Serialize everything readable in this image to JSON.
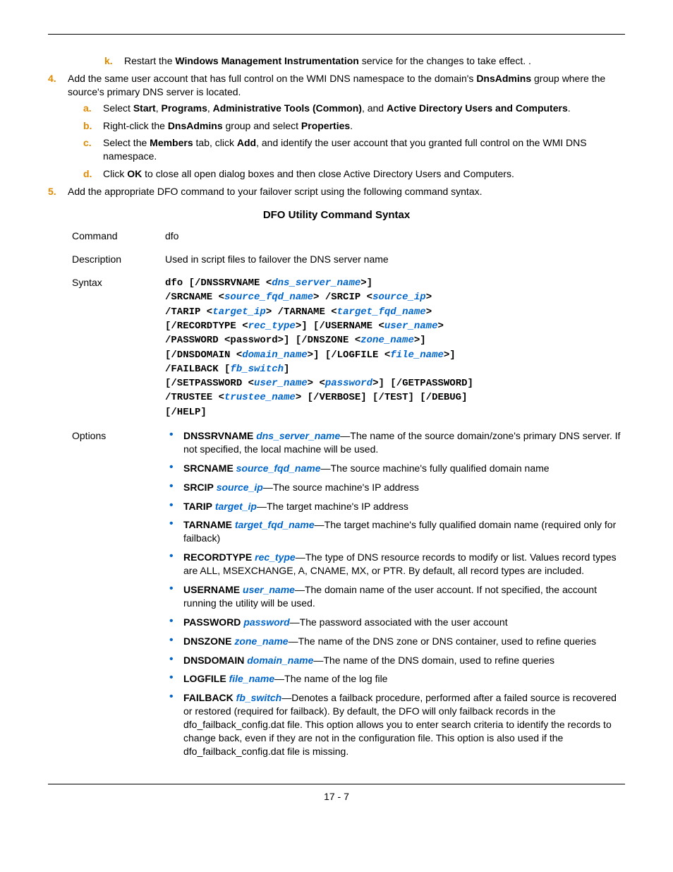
{
  "pageNumber": "17 - 7",
  "step_k_marker": "k.",
  "step_k_p1": "Restart the ",
  "step_k_b1": "Windows Management Instrumentation",
  "step_k_p2": " service for the changes to take effect. .",
  "step_4_marker": "4.",
  "step_4_p1": "Add the same user account that has full control on the WMI DNS namespace to the domain's ",
  "step_4_b1": "DnsAdmins",
  "step_4_p2": " group where the source's primary DNS server is located.",
  "step_4a_marker": "a.",
  "step_4a_p1": "Select ",
  "step_4a_b1": "Start",
  "step_4a_p2": ", ",
  "step_4a_b2": "Programs",
  "step_4a_p3": ", ",
  "step_4a_b3": "Administrative Tools (Common)",
  "step_4a_p4": ", and ",
  "step_4a_b4": "Active Directory Users and Computers",
  "step_4a_p5": ".",
  "step_4b_marker": "b.",
  "step_4b_p1": "Right-click the ",
  "step_4b_b1": "DnsAdmins",
  "step_4b_p2": " group and select ",
  "step_4b_b2": "Properties",
  "step_4b_p3": ".",
  "step_4c_marker": "c.",
  "step_4c_p1": "Select the ",
  "step_4c_b1": "Members",
  "step_4c_p2": " tab, click ",
  "step_4c_b2": "Add",
  "step_4c_p3": ", and identify the user account that you granted full control on the WMI DNS namespace.",
  "step_4d_marker": "d.",
  "step_4d_p1": "Click ",
  "step_4d_b1": "OK",
  "step_4d_p2": " to close all open dialog boxes and then close Active Directory Users and Computers.",
  "step_5_marker": "5.",
  "step_5_p1": "Add the appropriate DFO command to your failover script using the following command syntax.",
  "sectionTitle": "DFO Utility Command Syntax",
  "labels": {
    "command": "Command",
    "description": "Description",
    "syntax": "Syntax",
    "options": "Options"
  },
  "commandVal": "dfo",
  "descriptionVal": "Used in script files to failover the DNS server name",
  "syntax": {
    "s1a": "dfo [/DNSSRVNAME <",
    "s1p": "dns_server_name",
    "s1b": ">]",
    "s2a": "/SRCNAME <",
    "s2p": "source_fqd_name",
    "s2b": "> /SRCIP <",
    "s2p2": "source_ip",
    "s2c": ">",
    "s3a": "/TARIP <",
    "s3p": "target_ip",
    "s3b": "> /TARNAME <",
    "s3p2": "target_fqd_name",
    "s3c": ">",
    "s4a": "[/RECORDTYPE <",
    "s4p": "rec_type",
    "s4b": ">] [/USERNAME <",
    "s4p2": "user_name",
    "s4c": ">",
    "s5a": "/PASSWORD <password>] [/DNSZONE <",
    "s5p": "zone_name",
    "s5b": ">]",
    "s6a": "[/DNSDOMAIN <",
    "s6p": "domain_name",
    "s6b": ">] [/LOGFILE <",
    "s6p2": "file_name",
    "s6c": ">]",
    "s7a": "/FAILBACK [",
    "s7p": "fb_switch",
    "s7b": "]",
    "s8a": "[/SETPASSWORD <",
    "s8p": "user_name",
    "s8b": "> <",
    "s8p2": "password",
    "s8c": ">] [/GETPASSWORD]",
    "s9a": "/TRUSTEE <",
    "s9p": "trustee_name",
    "s9b": "> [/VERBOSE] [/TEST] [/DEBUG]",
    "s10a": "[/HELP]"
  },
  "opts": [
    {
      "k": "DNSSRVNAME",
      "p": "dns_server_name",
      "t": "—The name of the source domain/zone's primary DNS server. If not specified, the local machine will be used."
    },
    {
      "k": "SRCNAME",
      "p": "source_fqd_name",
      "t": "—The source machine's fully qualified domain name"
    },
    {
      "k": "SRCIP",
      "p": "source_ip",
      "t": "—The source machine's IP address"
    },
    {
      "k": "TARIP",
      "p": "target_ip",
      "t": "—The target machine's IP address"
    },
    {
      "k": "TARNAME",
      "p": "target_fqd_name",
      "t": "—The target machine's fully qualified domain name (required only for failback)"
    },
    {
      "k": "RECORDTYPE",
      "p": "rec_type",
      "t": "—The type of DNS resource records to modify or list. Values record types are ALL, MSEXCHANGE, A, CNAME, MX, or PTR. By default, all record types are included."
    },
    {
      "k": "USERNAME",
      "p": "user_name",
      "t": "—The domain name of the user account. If not specified, the account running the utility will be used."
    },
    {
      "k": "PASSWORD",
      "p": "password",
      "t": "—The password associated with the user account"
    },
    {
      "k": "DNSZONE",
      "p": "zone_name",
      "t": "—The name of the DNS zone or DNS container, used to refine queries"
    },
    {
      "k": "DNSDOMAIN",
      "p": "domain_name",
      "t": "—The name of the DNS domain, used to refine queries"
    },
    {
      "k": "LOGFILE",
      "p": "file_name",
      "t": "—The name of the log file"
    },
    {
      "k": "FAILBACK",
      "p": "fb_switch",
      "t": "—Denotes a failback procedure, performed after a failed source is recovered or restored (required for failback). By default, the DFO will only failback records in the dfo_failback_config.dat file. This option allows you to enter search criteria to identify the records to change back, even if they are not in the configuration file. This option is also used if the dfo_failback_config.dat file is missing."
    }
  ]
}
